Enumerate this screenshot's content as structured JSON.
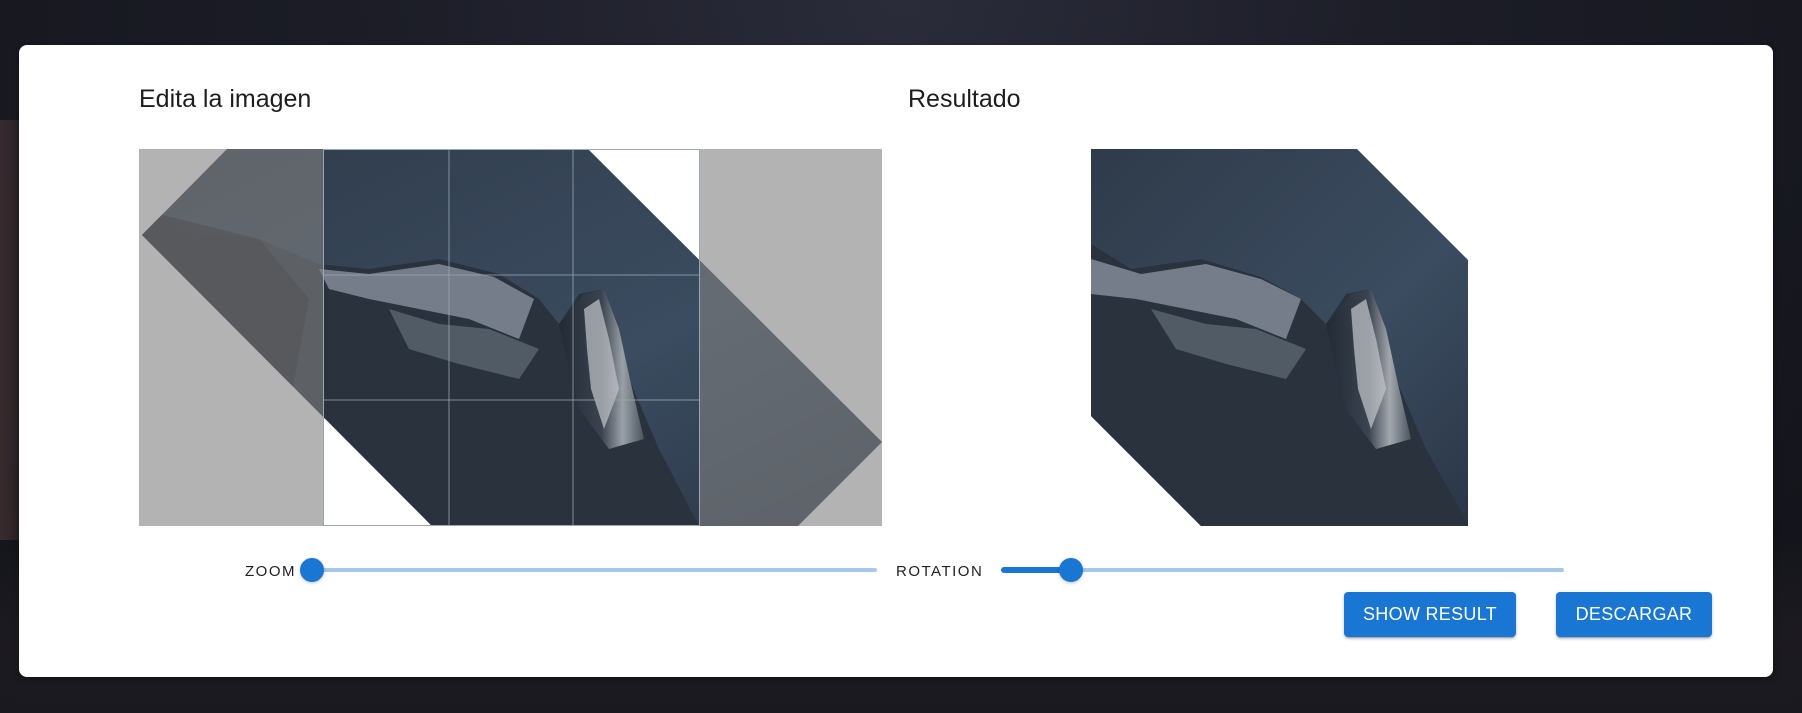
{
  "editor": {
    "title": "Edita la imagen"
  },
  "result": {
    "title": "Resultado"
  },
  "controls": {
    "zoom": {
      "label": "ZOOM",
      "value": 0.0
    },
    "rotation": {
      "label": "ROTATION",
      "value": 0.125
    }
  },
  "actions": {
    "show_result_label": "SHOW RESULT",
    "download_label": "DESCARGAR"
  },
  "colors": {
    "accent": "#1976d2",
    "accent_light": "#a5c8eb",
    "overlay": "#808080"
  }
}
